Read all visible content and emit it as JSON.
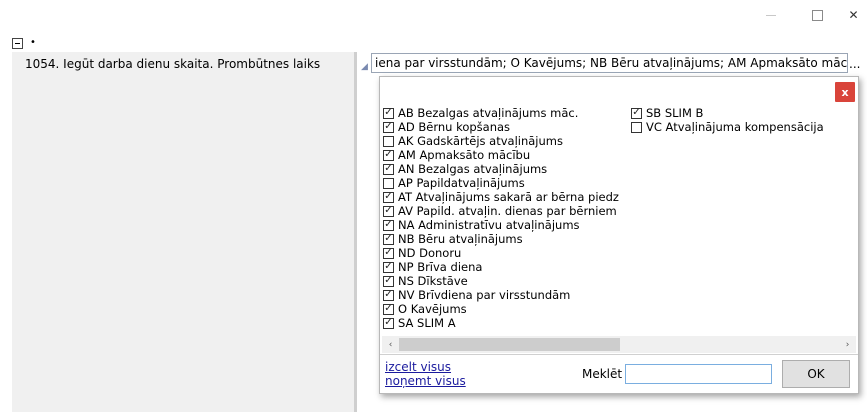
{
  "window": {
    "minimize_glyph": "–",
    "close_glyph": "✕"
  },
  "tree": {
    "bullet": "•",
    "row_label": "1054. Iegūt darba dienu skaita. Prombūtnes laiks"
  },
  "field": {
    "value": "iena par virsstundām; O Kavējums; NB Bēru atvaļinājums; AM Apmaksāto mācību",
    "ellipsis": "..."
  },
  "popup": {
    "close_label": "x",
    "column1": [
      {
        "label": "AB Bezalgas atvaļinājums māc.",
        "checked": true
      },
      {
        "label": "AD Bērnu kopšanas",
        "checked": true
      },
      {
        "label": "AK Gadskārtējs atvaļinājums",
        "checked": false
      },
      {
        "label": "AM Apmaksāto mācību",
        "checked": true
      },
      {
        "label": "AN Bezalgas atvaļinājums",
        "checked": true
      },
      {
        "label": "AP Papildatvaļinājums",
        "checked": false
      },
      {
        "label": "AT Atvaļinājums sakarā ar bērna piedz",
        "checked": true
      },
      {
        "label": "AV Papild. atvaļin. dienas par bērniem",
        "checked": true
      },
      {
        "label": "NA Administratīvu atvaļinājums",
        "checked": true
      },
      {
        "label": "NB Bēru atvaļinājums",
        "checked": true
      },
      {
        "label": "ND Donoru",
        "checked": true
      },
      {
        "label": "NP Brīva diena",
        "checked": true
      },
      {
        "label": "NS Dīkstāve",
        "checked": true
      },
      {
        "label": "NV Brīvdiena par virsstundām",
        "checked": true
      },
      {
        "label": "O Kavējums",
        "checked": true
      },
      {
        "label": "SA SLIM A",
        "checked": true
      }
    ],
    "column2": [
      {
        "label": "SB SLIM B",
        "checked": true
      },
      {
        "label": "VC Atvaļinājuma kompensācija",
        "checked": false
      }
    ],
    "select_all": "izcelt visus",
    "clear_all": "noņemt visus",
    "search_label": "Meklēt",
    "search_value": "",
    "ok_label": "OK",
    "scroll_left": "‹",
    "scroll_right": "›"
  }
}
